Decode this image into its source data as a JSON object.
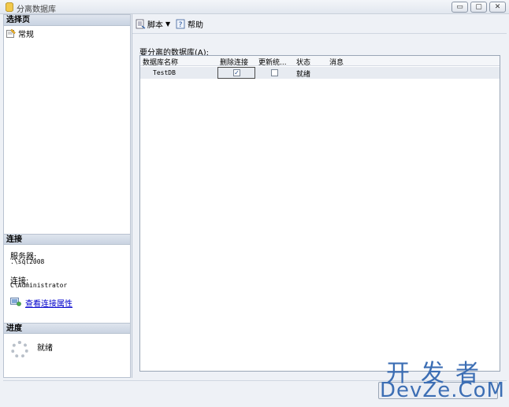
{
  "window": {
    "title": "分离数据库",
    "buttons": [
      "▭",
      "▢",
      "✕"
    ]
  },
  "left": {
    "select_page_header": "选择页",
    "pages": [
      {
        "label": "常规",
        "icon": "page-icon"
      }
    ],
    "connection_header": "连接",
    "server_label": "服务器:",
    "server_value": ".\\sql2008",
    "connection_label": "连接:",
    "connection_value": "C\\Administrator",
    "view_props_link": "查看连接属性",
    "progress_header": "进度",
    "progress_status": "就绪"
  },
  "toolbar": {
    "script_label": "脚本",
    "dropdown": "▼",
    "help_label": "帮助"
  },
  "grid": {
    "caption": "要分离的数据库(A):",
    "columns": [
      "数据库名称",
      "删除连接",
      "更新统...",
      "状态",
      "消息"
    ],
    "rows": [
      {
        "name": "TestDB",
        "drop_connections": true,
        "update_stats": false,
        "status": "就绪",
        "message": ""
      }
    ]
  },
  "watermark": {
    "line1": "开发者",
    "line2": "DevZe.CoM"
  },
  "colors": {
    "link": "#0000cc",
    "panel_bg": "#eef1f6",
    "header_bg": "#c9d3e2",
    "watermark": "#3c6eb4"
  }
}
